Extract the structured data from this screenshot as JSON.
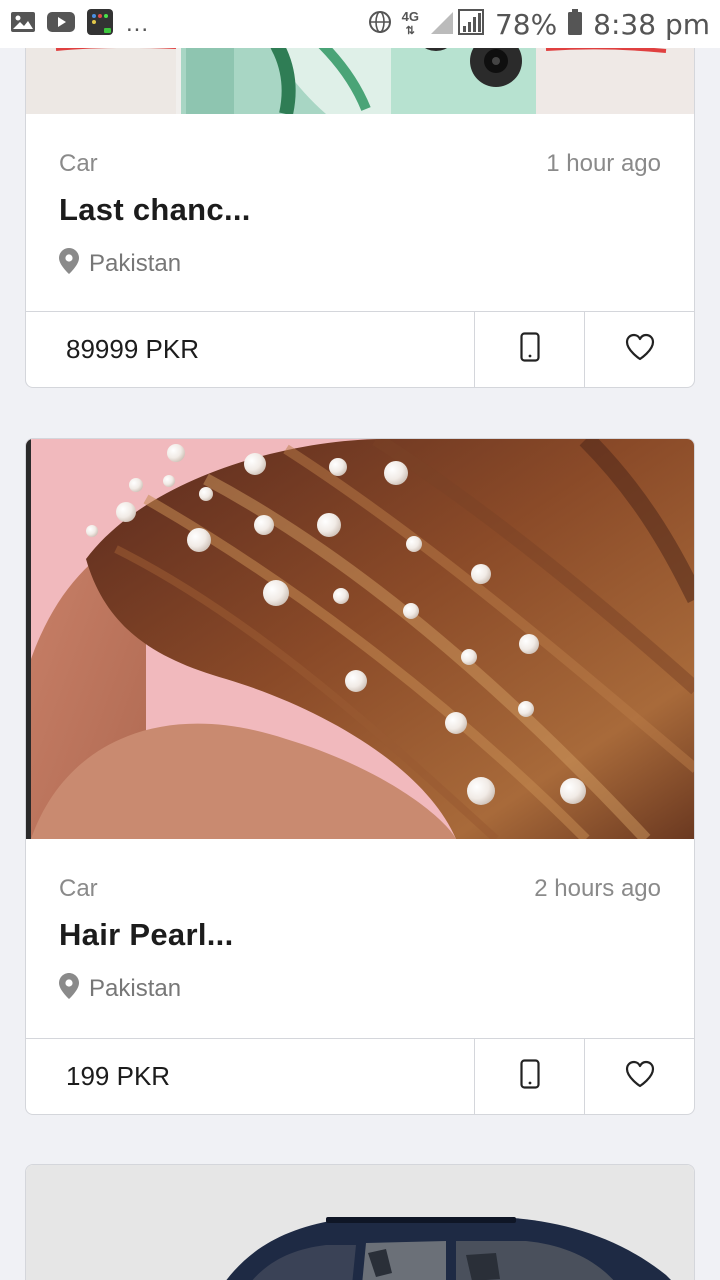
{
  "status_bar": {
    "battery": "78%",
    "time": "8:38 pm",
    "network": "4G",
    "more": "..."
  },
  "listings": [
    {
      "category": "Car",
      "time_ago": "1 hour ago",
      "title": "Last chanc...",
      "location": "Pakistan",
      "price": "89999 PKR"
    },
    {
      "category": "Car",
      "time_ago": "2 hours ago",
      "title": "Hair Pearl...",
      "location": "Pakistan",
      "price": "199 PKR"
    }
  ],
  "colors": {
    "background": "#f0f1f5",
    "card": "#ffffff",
    "border": "#d4d6db",
    "muted_text": "#8a8a8a",
    "title_text": "#1c1c1c"
  },
  "icons": [
    "gallery-icon",
    "youtube-icon",
    "app-icon",
    "globe-icon",
    "signal-icon",
    "battery-icon",
    "location-pin-icon",
    "phone-icon",
    "heart-icon"
  ]
}
